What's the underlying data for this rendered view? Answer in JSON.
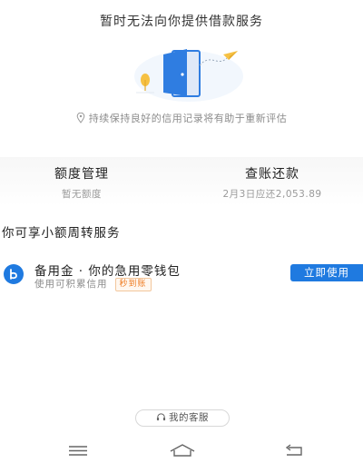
{
  "status": {
    "title": "暂时无法向你提供借款服务",
    "tip": "持续保持良好的信用记录将有助于重新评估"
  },
  "summary": {
    "quota": {
      "title": "额度管理",
      "subtitle": "暂无额度"
    },
    "repay": {
      "title": "查账还款",
      "subtitle": "2月3日应还2,053.89"
    }
  },
  "section": {
    "title": "你可享小额周转服务"
  },
  "service": {
    "name": "备用金 · 你的急用零钱包",
    "desc": "使用可积累信用",
    "badge": "秒到账",
    "button": "立即使用",
    "icon": "b-logo-icon"
  },
  "customer_service": {
    "label": "我的客服"
  },
  "colors": {
    "accent": "#1f7ae0",
    "badge": "#ef7d24",
    "illustration_door": "#2f7de1",
    "illustration_accent": "#f6c143"
  },
  "navbar": {
    "items": [
      "menu-icon",
      "home-icon",
      "back-icon"
    ]
  }
}
